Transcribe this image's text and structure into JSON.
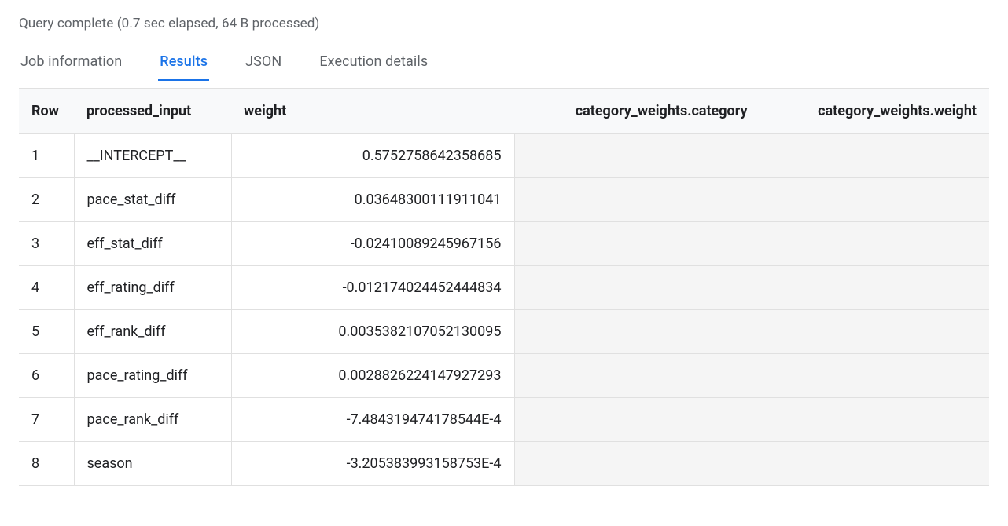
{
  "status": "Query complete (0.7 sec elapsed, 64 B processed)",
  "tabs": [
    {
      "label": "Job information",
      "active": false
    },
    {
      "label": "Results",
      "active": true
    },
    {
      "label": "JSON",
      "active": false
    },
    {
      "label": "Execution details",
      "active": false
    }
  ],
  "table": {
    "headers": {
      "row": "Row",
      "processed_input": "processed_input",
      "weight": "weight",
      "category_weights_category": "category_weights.category",
      "category_weights_weight": "category_weights.weight"
    },
    "rows": [
      {
        "row": "1",
        "processed_input": "__INTERCEPT__",
        "weight": "0.5752758642358685",
        "category": "",
        "cweight": ""
      },
      {
        "row": "2",
        "processed_input": "pace_stat_diff",
        "weight": "0.03648300111911041",
        "category": "",
        "cweight": ""
      },
      {
        "row": "3",
        "processed_input": "eff_stat_diff",
        "weight": "-0.02410089245967156",
        "category": "",
        "cweight": ""
      },
      {
        "row": "4",
        "processed_input": "eff_rating_diff",
        "weight": "-0.012174024452444834",
        "category": "",
        "cweight": ""
      },
      {
        "row": "5",
        "processed_input": "eff_rank_diff",
        "weight": "0.0035382107052130095",
        "category": "",
        "cweight": ""
      },
      {
        "row": "6",
        "processed_input": "pace_rating_diff",
        "weight": "0.0028826224147927293",
        "category": "",
        "cweight": ""
      },
      {
        "row": "7",
        "processed_input": "pace_rank_diff",
        "weight": "-7.484319474178544E-4",
        "category": "",
        "cweight": ""
      },
      {
        "row": "8",
        "processed_input": "season",
        "weight": "-3.205383993158753E-4",
        "category": "",
        "cweight": ""
      }
    ]
  }
}
